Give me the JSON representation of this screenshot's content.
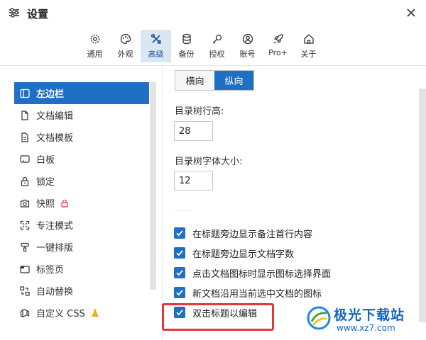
{
  "window": {
    "title": "设置"
  },
  "tabs": [
    {
      "label": "通用",
      "icon": "gear-icon"
    },
    {
      "label": "外观",
      "icon": "palette-icon"
    },
    {
      "label": "高级",
      "icon": "tools-icon",
      "active": true
    },
    {
      "label": "备份",
      "icon": "database-icon"
    },
    {
      "label": "授权",
      "icon": "key-icon"
    },
    {
      "label": "账号",
      "icon": "user-circle-icon"
    },
    {
      "label": "Pro+",
      "icon": "rocket-icon"
    },
    {
      "label": "关于",
      "icon": "home-icon"
    }
  ],
  "sidebar": {
    "items": [
      {
        "label": "左边栏",
        "icon": "sidebar-icon",
        "active": true
      },
      {
        "label": "文档编辑",
        "icon": "document-icon"
      },
      {
        "label": "文档模板",
        "icon": "template-icon"
      },
      {
        "label": "白板",
        "icon": "whiteboard-icon"
      },
      {
        "label": "锁定",
        "icon": "lock-icon"
      },
      {
        "label": "快照",
        "icon": "camera-icon",
        "badge": "lock-badge-icon"
      },
      {
        "label": "专注模式",
        "icon": "fullscreen-icon"
      },
      {
        "label": "一键排版",
        "icon": "brush-icon"
      },
      {
        "label": "标签页",
        "icon": "tab-icon"
      },
      {
        "label": "自动替换",
        "icon": "replace-icon"
      },
      {
        "label": "自定义 CSS",
        "icon": "css-icon",
        "badge": "flask-badge-icon"
      }
    ]
  },
  "content": {
    "orientation": {
      "options": [
        "横向",
        "纵向"
      ],
      "selected": "纵向"
    },
    "row_height": {
      "label": "目录树行高:",
      "value": "28"
    },
    "font_size": {
      "label": "目录树字体大小:",
      "value": "12"
    },
    "checkboxes": [
      {
        "label": "在标题旁边显示备注首行内容",
        "checked": true
      },
      {
        "label": "在标题旁边显示文档字数",
        "checked": true
      },
      {
        "label": "点击文档图标时显示图标选择界面",
        "checked": true
      },
      {
        "label": "新文档沿用当前选中文档的图标",
        "checked": true
      },
      {
        "label": "双击标题以编辑",
        "checked": true,
        "highlighted": true
      }
    ]
  },
  "watermark": {
    "name": "极光下载站",
    "url": "www.xz7.com"
  },
  "colors": {
    "accent": "#1f6fc5",
    "highlight": "#e53935",
    "tab_active_bg": "#dbe6f3"
  }
}
